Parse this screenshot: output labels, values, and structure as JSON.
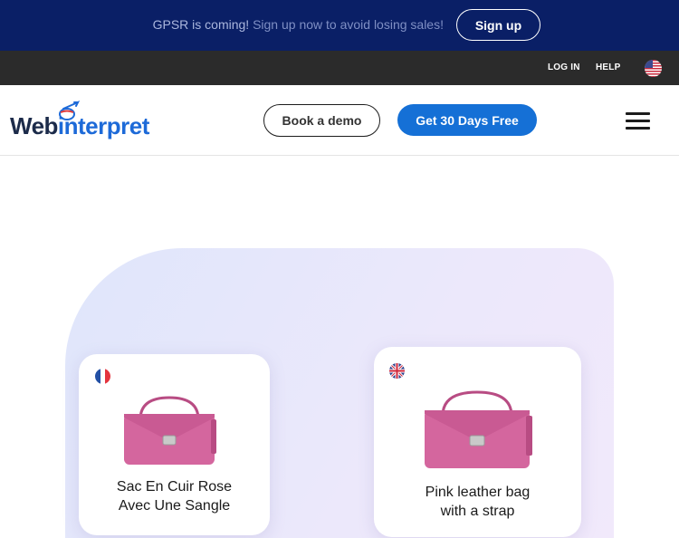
{
  "promo_bar": {
    "highlight": "GPSR is coming!",
    "message": " Sign up now to avoid losing sales!",
    "signup_label": "Sign up"
  },
  "utility_bar": {
    "login_label": "LOG IN",
    "help_label": "HELP",
    "language_icon": "us-flag-icon"
  },
  "header": {
    "logo_part1": "Web",
    "logo_part2": "interpret",
    "demo_label": "Book a demo",
    "trial_label": "Get 30 Days Free",
    "menu_icon": "hamburger-menu-icon"
  },
  "hero": {
    "card_french": {
      "flag_icon": "france-flag-icon",
      "line1": "Sac En Cuir Rose",
      "line2": "Avec Une Sangle"
    },
    "card_english": {
      "flag_icon": "uk-flag-icon",
      "line1": "Pink leather bag",
      "line2": "with a strap"
    }
  },
  "colors": {
    "promo_bg": "#0a1f66",
    "utility_bg": "#2b2b2b",
    "accent": "#1570d6",
    "bag_pink": "#d4669e"
  }
}
